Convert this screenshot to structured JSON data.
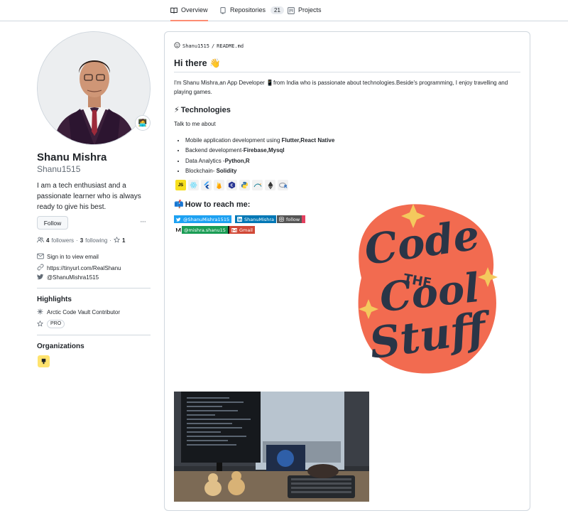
{
  "tabs": [
    {
      "label": "Overview",
      "icon": "book-icon",
      "selected": true
    },
    {
      "label": "Repositories",
      "icon": "repo-icon",
      "count": "21"
    },
    {
      "label": "Projects",
      "icon": "project-icon"
    }
  ],
  "profile": {
    "name": "Shanu Mishra",
    "login": "Shanu1515",
    "bio": "I am a tech enthusiast and a passionate learner who is always ready to give his best.",
    "status_emoji": "🧑‍💻",
    "follow_label": "Follow",
    "more_label": "···",
    "followers_count": "4",
    "followers_label": "followers",
    "following_count": "3",
    "following_label": "following",
    "stars_count": "1",
    "email_text": "Sign in to view email",
    "website": "https://tinyurl.com/RealShanu",
    "twitter": "@ShanuMishra1515"
  },
  "highlights": {
    "title": "Highlights",
    "items": [
      {
        "label": "Arctic Code Vault Contributor",
        "icon": "arctic-vault-icon"
      },
      {
        "label": "PRO",
        "icon": "star-icon"
      }
    ]
  },
  "organizations": {
    "title": "Organizations"
  },
  "readme": {
    "owner": "Shanu1515",
    "separator": "/",
    "file": "README.md",
    "heading": "Hi there",
    "heading_emoji": "👋",
    "intro": "I'm Shanu Mishra,an App Developer 📱from India who is passionate about technologies.Beside's programming, I enjoy travelling and playing games.",
    "tech_emoji": "⚡",
    "tech_title": "Technologies",
    "talk": "Talk to me about",
    "list": [
      {
        "prefix": "Mobile application development using ",
        "bold": "Flutter,React Native"
      },
      {
        "prefix": "Backend development-",
        "bold": "Firebase,Mysql"
      },
      {
        "prefix": "Data Analytics -",
        "bold": "Python,R"
      },
      {
        "prefix": "Blockchain- ",
        "bold": "Solidity"
      }
    ],
    "tech_icons": [
      "javascript-icon",
      "react-icon",
      "flutter-icon",
      "firebase-icon",
      "c-icon",
      "python-icon",
      "mysql-icon",
      "ethereum-icon",
      "r-icon"
    ],
    "reach_emoji": "📫",
    "reach_title": "How to reach me:",
    "badges": [
      {
        "label": "@ShanuMishra1515",
        "icon": "twitter-icon",
        "color": "#1da1f2"
      },
      {
        "label": "ShanuMishra",
        "icon": "linkedin-icon",
        "color": "#0077b5"
      },
      {
        "label": "follow",
        "icon": "instagram-icon",
        "color": "#555555"
      },
      {
        "label": "@mishra.shanu15",
        "icon": "medium-icon",
        "color": "#12100e"
      },
      {
        "label": "Gmail",
        "icon": "gmail-icon",
        "color": "#d14836"
      }
    ]
  },
  "colors": {
    "accent_tab": "#fd8c73",
    "sticker_bg": "#f26b50",
    "sticker_text": "#2a3547",
    "sparkle": "#f4c95d"
  }
}
